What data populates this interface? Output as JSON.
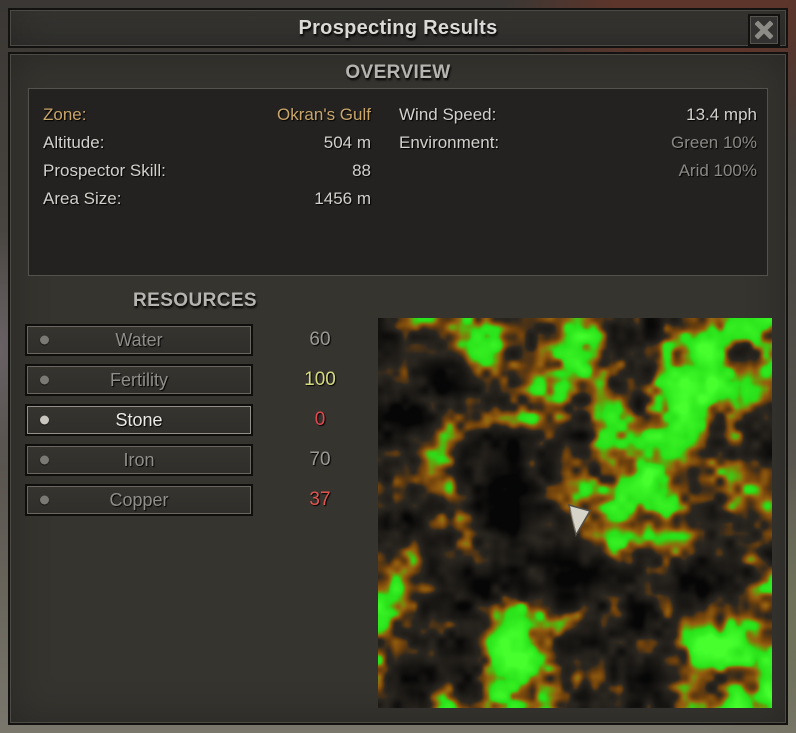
{
  "window": {
    "title": "Prospecting Results"
  },
  "overview": {
    "heading": "OVERVIEW",
    "left": [
      {
        "label": "Zone:",
        "value": "Okran's Gulf"
      },
      {
        "label": "Altitude:",
        "value": "504 m"
      },
      {
        "label": "Prospector Skill:",
        "value": "88"
      },
      {
        "label": "Area Size:",
        "value": "1456 m"
      }
    ],
    "right": [
      {
        "label": "Wind Speed:",
        "value": "13.4 mph"
      },
      {
        "label": "Environment:",
        "value": "Green 10%"
      },
      {
        "label": "",
        "value": "Arid 100%"
      }
    ]
  },
  "resources": {
    "heading": "RESOURCES",
    "items": [
      {
        "label": "Water",
        "value": "60",
        "value_color": "#9c9a96",
        "selected": false
      },
      {
        "label": "Fertility",
        "value": "100",
        "value_color": "#d6da7f",
        "selected": false
      },
      {
        "label": "Stone",
        "value": "0",
        "value_color": "#e4474d",
        "selected": true
      },
      {
        "label": "Iron",
        "value": "70",
        "value_color": "#9c9a96",
        "selected": false
      },
      {
        "label": "Copper",
        "value": "37",
        "value_color": "#e4544e",
        "selected": false
      }
    ]
  },
  "map": {
    "description": "resource-density-map",
    "colors": {
      "background": "#050505",
      "arid_halo": "#96600f",
      "fertile_green": "#2ce11c"
    },
    "palette": [
      {
        "t": 0.0,
        "color": "#060606"
      },
      {
        "t": 0.4,
        "color": "#2a2620"
      },
      {
        "t": 0.5,
        "color": "#6e400c"
      },
      {
        "t": 0.58,
        "color": "#96600f"
      },
      {
        "t": 0.63,
        "color": "#6e960a"
      },
      {
        "t": 0.7,
        "color": "#28e119"
      },
      {
        "t": 1.0,
        "color": "#46ff2d"
      }
    ]
  },
  "ui_colors": {
    "zone_gold": "#c9a66a",
    "text": "#d3d1cd",
    "dim_text": "#8b8985",
    "heading": "#b6b4b0"
  }
}
